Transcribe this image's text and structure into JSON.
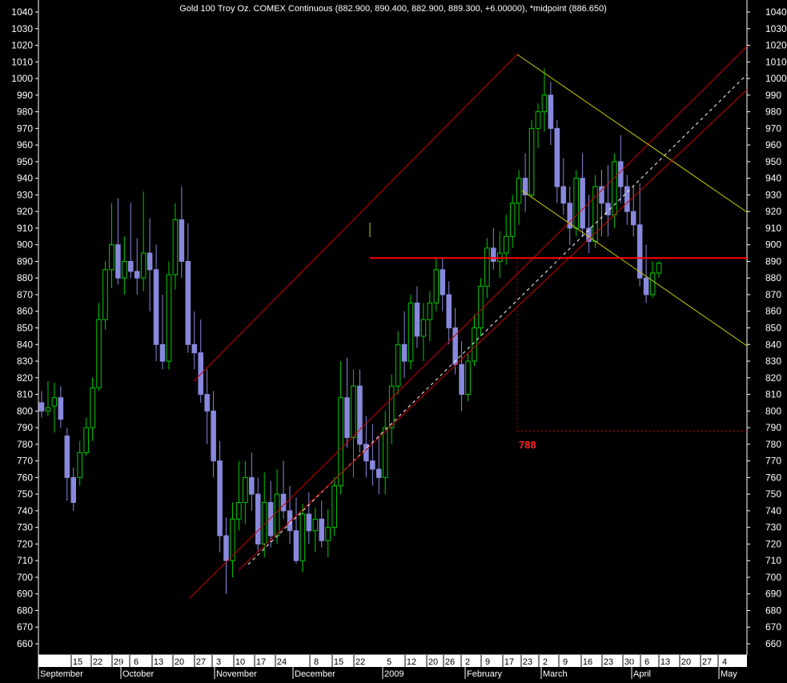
{
  "chart_data": {
    "type": "candlestick",
    "title": "Gold 100 Troy Oz. COMEX Continuous (882.900, 890.400, 882.900, 889.300, +6.00000), *midpoint (886.650)",
    "ylim": [
      655,
      1045
    ],
    "y_ticks": [
      660,
      670,
      680,
      690,
      700,
      710,
      720,
      730,
      740,
      750,
      760,
      770,
      780,
      790,
      800,
      810,
      820,
      830,
      840,
      850,
      860,
      870,
      880,
      890,
      900,
      910,
      920,
      930,
      940,
      950,
      960,
      970,
      980,
      990,
      1000,
      1010,
      1020,
      1030,
      1040
    ],
    "x_tick_labels": [
      "15",
      "22",
      "29",
      "6",
      "13",
      "20",
      "27",
      "3",
      "10",
      "17",
      "24",
      "8",
      "15",
      "22",
      "5",
      "12",
      "20",
      "26",
      "2",
      "9",
      "17",
      "23",
      "2",
      "9",
      "16",
      "23",
      "30",
      "6",
      "13",
      "20",
      "27",
      "4"
    ],
    "x_month_labels": [
      "September",
      "October",
      "November",
      "December",
      "2009",
      "February",
      "March",
      "April",
      "May"
    ],
    "annotations": {
      "resistance_level": 892,
      "target_label": "788",
      "target_level": 788
    },
    "colors": {
      "background": "#000000",
      "text": "#ffffff",
      "up_candle": "#00cc00",
      "down_candle": "#8888dd",
      "channel": "#cc0000",
      "horizontal": "#ff0000",
      "midline": "#ffffff",
      "down_channel": "#cccc00",
      "target_text": "#ff2020"
    },
    "series": [
      {
        "ohlc": [
          [
            805,
            812,
            796,
            800
          ],
          [
            800,
            818,
            797,
            802
          ],
          [
            803,
            817,
            787,
            808
          ],
          [
            808,
            815,
            790,
            795
          ],
          [
            785,
            790,
            746,
            760
          ],
          [
            760,
            766,
            740,
            745
          ],
          [
            760,
            782,
            755,
            775
          ],
          [
            775,
            796,
            773,
            790
          ],
          [
            790,
            820,
            782,
            814
          ],
          [
            814,
            865,
            812,
            855
          ],
          [
            855,
            890,
            849,
            885
          ],
          [
            885,
            925,
            874,
            900
          ],
          [
            900,
            928,
            876,
            880
          ],
          [
            880,
            905,
            870,
            890
          ],
          [
            890,
            925,
            880,
            884
          ],
          [
            884,
            904,
            870,
            880
          ],
          [
            880,
            932,
            872,
            895
          ],
          [
            895,
            916,
            860,
            885
          ],
          [
            885,
            900,
            830,
            840
          ],
          [
            840,
            870,
            825,
            830
          ],
          [
            830,
            890,
            825,
            882
          ],
          [
            882,
            925,
            873,
            915
          ],
          [
            915,
            935,
            880,
            890
          ],
          [
            890,
            913,
            835,
            840
          ],
          [
            840,
            860,
            825,
            835
          ],
          [
            835,
            855,
            805,
            810
          ],
          [
            810,
            825,
            780,
            800
          ],
          [
            800,
            812,
            760,
            770
          ],
          [
            770,
            782,
            715,
            725
          ],
          [
            725,
            736,
            690,
            710
          ],
          [
            710,
            745,
            700,
            735
          ],
          [
            735,
            770,
            728,
            745
          ],
          [
            745,
            770,
            732,
            760
          ],
          [
            760,
            775,
            740,
            750
          ],
          [
            750,
            760,
            715,
            720
          ],
          [
            720,
            763,
            712,
            745
          ],
          [
            745,
            758,
            718,
            725
          ],
          [
            725,
            765,
            720,
            750
          ],
          [
            750,
            770,
            735,
            740
          ],
          [
            740,
            755,
            720,
            728
          ],
          [
            728,
            748,
            708,
            710
          ],
          [
            710,
            744,
            703,
            738
          ],
          [
            738,
            751,
            720,
            728
          ],
          [
            728,
            742,
            715,
            735
          ],
          [
            735,
            746,
            718,
            722
          ],
          [
            722,
            741,
            712,
            730
          ],
          [
            730,
            760,
            725,
            755
          ],
          [
            755,
            830,
            750,
            808
          ],
          [
            808,
            832,
            778,
            784
          ],
          [
            784,
            825,
            760,
            815
          ],
          [
            815,
            825,
            775,
            780
          ],
          [
            780,
            797,
            760,
            770
          ],
          [
            770,
            792,
            755,
            765
          ],
          [
            765,
            785,
            750,
            760
          ],
          [
            760,
            800,
            750,
            790
          ],
          [
            790,
            822,
            780,
            815
          ],
          [
            815,
            848,
            810,
            840
          ],
          [
            840,
            860,
            820,
            830
          ],
          [
            830,
            870,
            825,
            865
          ],
          [
            865,
            875,
            838,
            845
          ],
          [
            845,
            865,
            830,
            855
          ],
          [
            855,
            872,
            842,
            865
          ],
          [
            865,
            892,
            860,
            885
          ],
          [
            885,
            892,
            860,
            870
          ],
          [
            870,
            878,
            840,
            850
          ],
          [
            850,
            862,
            822,
            828
          ],
          [
            828,
            842,
            800,
            810
          ],
          [
            810,
            835,
            806,
            830
          ],
          [
            830,
            858,
            827,
            850
          ],
          [
            850,
            880,
            845,
            875
          ],
          [
            875,
            904,
            868,
            898
          ],
          [
            898,
            910,
            885,
            890
          ],
          [
            890,
            908,
            880,
            895
          ],
          [
            895,
            918,
            888,
            905
          ],
          [
            905,
            930,
            898,
            925
          ],
          [
            925,
            945,
            912,
            940
          ],
          [
            940,
            955,
            920,
            930
          ],
          [
            930,
            975,
            928,
            970
          ],
          [
            970,
            985,
            958,
            980
          ],
          [
            980,
            1006,
            968,
            990
          ],
          [
            990,
            998,
            960,
            970
          ],
          [
            970,
            975,
            925,
            935
          ],
          [
            935,
            952,
            918,
            925
          ],
          [
            925,
            935,
            900,
            910
          ],
          [
            910,
            945,
            905,
            940
          ],
          [
            940,
            955,
            905,
            910
          ],
          [
            910,
            930,
            895,
            902
          ],
          [
            902,
            942,
            898,
            935
          ],
          [
            935,
            945,
            905,
            925
          ],
          [
            925,
            948,
            905,
            918
          ],
          [
            918,
            955,
            910,
            950
          ],
          [
            950,
            966,
            925,
            935
          ],
          [
            935,
            942,
            912,
            920
          ],
          [
            920,
            935,
            905,
            912
          ],
          [
            912,
            937,
            875,
            880
          ],
          [
            880,
            900,
            865,
            870
          ],
          [
            870,
            890,
            868,
            883
          ],
          [
            883,
            890,
            880,
            889
          ]
        ]
      }
    ]
  }
}
